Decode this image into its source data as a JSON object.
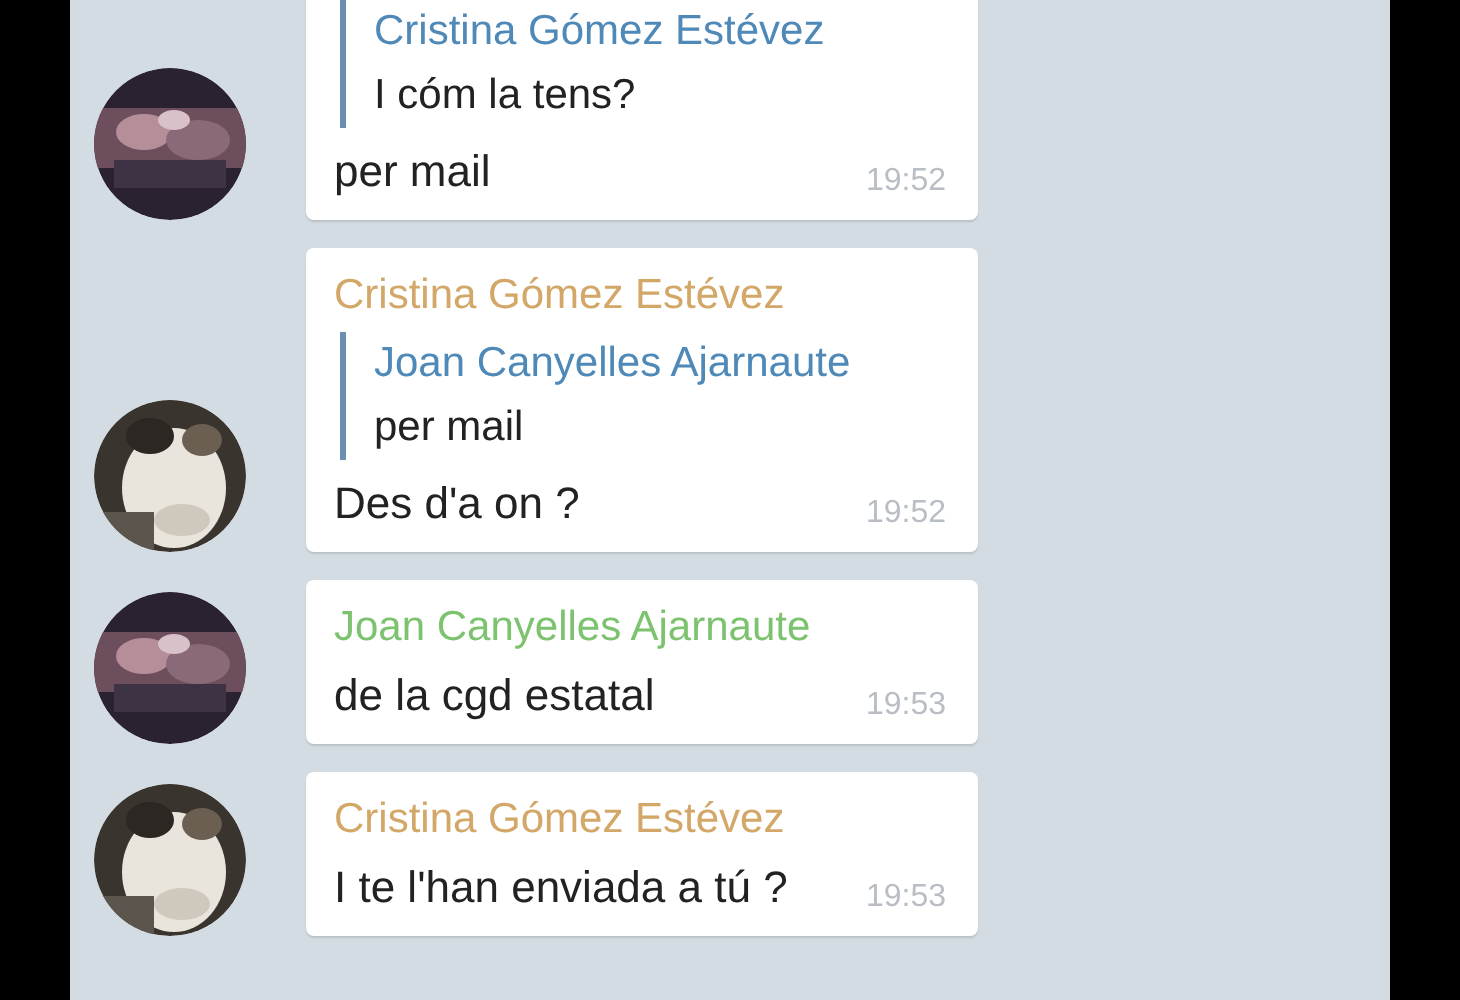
{
  "messages": [
    {
      "reply": {
        "name": "Cristina Gómez Estévez",
        "text": "I cóm la tens?"
      },
      "text": "per mail",
      "time": "19:52"
    },
    {
      "sender": {
        "name": "Cristina Gómez Estévez",
        "color": "#d2a767"
      },
      "reply": {
        "name": "Joan Canyelles Ajarnaute",
        "text": "per mail"
      },
      "text": "Des d'a on ?",
      "time": "19:52"
    },
    {
      "sender": {
        "name": "Joan Canyelles Ajarnaute",
        "color": "#7dc36f"
      },
      "text": "de la cgd estatal",
      "time": "19:53"
    },
    {
      "sender": {
        "name": "Cristina Gómez Estévez",
        "color": "#d2a767"
      },
      "text": "I te l'han enviada a tú ?",
      "time": "19:53"
    }
  ]
}
